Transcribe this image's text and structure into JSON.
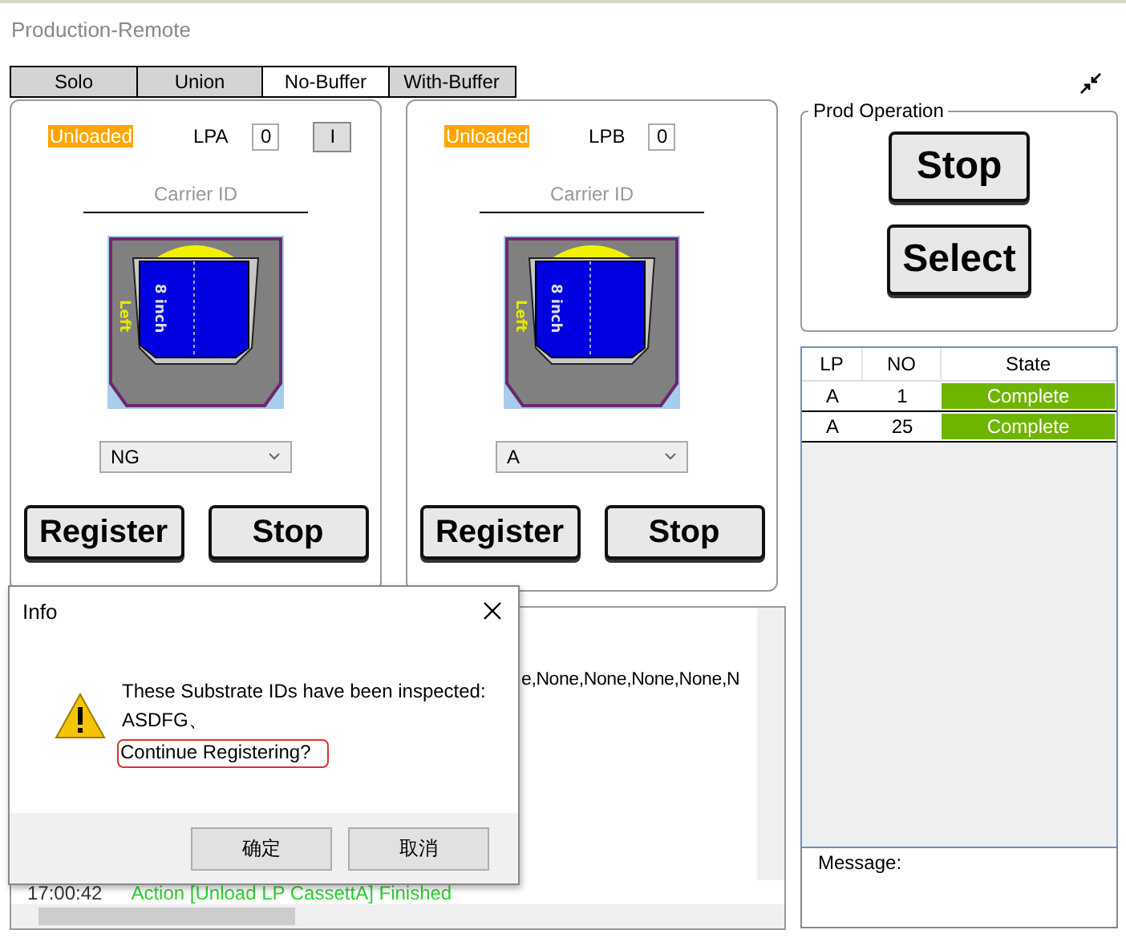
{
  "window": {
    "title": "Production-Remote"
  },
  "tabs": [
    {
      "label": "Solo",
      "selected": false
    },
    {
      "label": "Union",
      "selected": false
    },
    {
      "label": "No-Buffer",
      "selected": true
    },
    {
      "label": "With-Buffer",
      "selected": false
    }
  ],
  "load_ports": [
    {
      "status": "Unloaded",
      "name": "LPA",
      "count": "0",
      "extra_button": "I",
      "carrier_id": {
        "placeholder": "Carrier ID"
      },
      "carrier_size": "8 inch",
      "carrier_side": "Left",
      "grade": "NG",
      "buttons": [
        "Register",
        "Stop"
      ]
    },
    {
      "status": "Unloaded",
      "name": "LPB",
      "count": "0",
      "carrier_id": {
        "placeholder": "Carrier ID"
      },
      "carrier_size": "8 inch",
      "carrier_side": "Left",
      "grade": "A",
      "buttons": [
        "Register",
        "Stop"
      ]
    }
  ],
  "log": {
    "lines": [
      {
        "text": "e,None,None,None,None,N",
        "kind": "plain"
      },
      {
        "time": "17:00:42",
        "text": "Action [Unload LP CassettA] Finished",
        "kind": "success"
      }
    ]
  },
  "prod_operation": {
    "title": "Prod Operation",
    "buttons": [
      "Stop",
      "Select"
    ]
  },
  "table": {
    "columns": [
      "LP",
      "NO",
      "State"
    ],
    "rows": [
      {
        "lp": "A",
        "no": "1",
        "state": "Complete",
        "color": "#6eb500"
      },
      {
        "lp": "A",
        "no": "25",
        "state": "Complete",
        "color": "#6eb500"
      }
    ]
  },
  "message": {
    "label": "Message:"
  },
  "dialog": {
    "title": "Info",
    "lines": [
      "These Substrate IDs have been inspected:",
      "ASDFG、"
    ],
    "question": "Continue Registering?",
    "buttons": [
      "确定",
      "取消"
    ]
  }
}
